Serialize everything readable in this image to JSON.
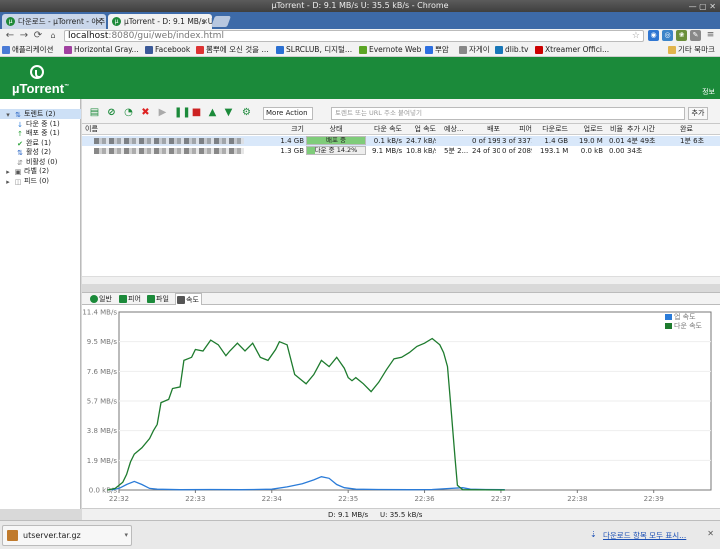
{
  "window": {
    "title": "µTorrent - D: 9.1 MB/s U: 35.5 kB/s - Chrome"
  },
  "tabs": [
    {
      "label": "다운로드 - µTorrent - 아주",
      "active": false
    },
    {
      "label": "µTorrent - D: 9.1 MB/s U",
      "active": true
    }
  ],
  "omnibox": {
    "host": "localhost",
    "path": ":8080/gui/web/index.html"
  },
  "bookmarks": [
    {
      "label": "애플리케이션",
      "color": "#4a7bd6"
    },
    {
      "label": "Horizontal Gray...",
      "color": "#a040a0"
    },
    {
      "label": "Facebook",
      "color": "#3b5998"
    },
    {
      "label": "뽐뿌에 오신 것을 ...",
      "color": "#d33"
    },
    {
      "label": "SLRCLUB, 디지털...",
      "color": "#2a6fd1"
    },
    {
      "label": "Evernote Web",
      "color": "#5ba525"
    },
    {
      "label": "뿌암",
      "color": "#2d6fe0"
    },
    {
      "label": "자게이",
      "color": "#888"
    },
    {
      "label": "dlib.tv",
      "color": "#1877b8"
    },
    {
      "label": "Xtreamer Offici...",
      "color": "#c00"
    },
    {
      "label": "기타 북마크",
      "color": "#e1b44c"
    }
  ],
  "header": {
    "logo": "µTorrent",
    "logo_tm": "™",
    "info_link": "정보"
  },
  "sidebar": {
    "categories": [
      {
        "label": "토렌트 (2)",
        "selected": true,
        "indent": 0,
        "icon": "torrents-icon",
        "glyph": "⇅",
        "color": "#2a66c5"
      },
      {
        "label": "다운 중 (1)",
        "selected": false,
        "indent": 1,
        "icon": "download-icon",
        "glyph": "↓",
        "color": "#2a7bd8"
      },
      {
        "label": "배포 중 (1)",
        "selected": false,
        "indent": 1,
        "icon": "upload-icon",
        "glyph": "↑",
        "color": "#2ea33c"
      },
      {
        "label": "완료 (1)",
        "selected": false,
        "indent": 1,
        "icon": "check-icon",
        "glyph": "✔",
        "color": "#2ea33c"
      },
      {
        "label": "활성 (2)",
        "selected": false,
        "indent": 1,
        "icon": "active-icon",
        "glyph": "⇅",
        "color": "#2a66c5"
      },
      {
        "label": "비활성 (0)",
        "selected": false,
        "indent": 1,
        "icon": "inactive-icon",
        "glyph": "⇵",
        "color": "#888"
      },
      {
        "label": "라벨 (2)",
        "selected": false,
        "indent": 0,
        "icon": "label-icon",
        "glyph": "▣",
        "color": "#555"
      },
      {
        "label": "피드 (0)",
        "selected": false,
        "indent": 0,
        "icon": "feed-icon",
        "glyph": "◫",
        "color": "#888"
      }
    ]
  },
  "toolbar": {
    "more_action": "More Action",
    "url_placeholder": "토렌트 또는 URL 주소 붙여넣기",
    "add_label": "추가"
  },
  "table": {
    "headers": [
      "이름",
      "크기",
      "상태",
      "다운 속도",
      "업 속도",
      "예상...",
      "배포",
      "피어",
      "다운로드",
      "업로드",
      "비율",
      "추가 시간",
      "완료"
    ],
    "rows": [
      {
        "size": "1.4 GB",
        "status": "배포 중",
        "progress": 1.0,
        "down": "0.1 kB/s",
        "up": "24.7 kB/s",
        "eta": "",
        "seeds": "0 of 199",
        "peers": "3 of 3371",
        "downloaded": "1.4 GB",
        "uploaded": "19.0 MB",
        "ratio": "0.01",
        "added": "4분 49초",
        "completed": "1분 6초",
        "selected": true
      },
      {
        "size": "1.3 GB",
        "status": "다운 중 14.2%",
        "progress": 0.142,
        "down": "9.1 MB/s",
        "up": "10.8 kB/s",
        "eta": "5분 2...",
        "seeds": "24 of 30",
        "peers": "0 of 2089",
        "downloaded": "193.1 MB",
        "uploaded": "0.0 kB",
        "ratio": "0.00",
        "added": "34초",
        "completed": "",
        "selected": false
      }
    ]
  },
  "detail_tabs": [
    {
      "label": "일반",
      "icon": "info-icon",
      "active": false
    },
    {
      "label": "피어",
      "icon": "peers-icon",
      "active": false
    },
    {
      "label": "파일",
      "icon": "files-icon",
      "active": false
    },
    {
      "label": "속도",
      "icon": "speed-icon",
      "active": true
    }
  ],
  "chart_data": {
    "type": "line",
    "x_labels": [
      "22:32",
      "22:33",
      "22:34",
      "22:35",
      "22:36",
      "22:37",
      "22:38",
      "22:39"
    ],
    "x_range": [
      0,
      7.75
    ],
    "y_labels": [
      "0.0 kB/s",
      "1.9 MB/s",
      "3.8 MB/s",
      "5.7 MB/s",
      "7.6 MB/s",
      "9.5 MB/s",
      "11.4 MB/s"
    ],
    "ylim": [
      0,
      11.4
    ],
    "y_unit": "MB/s",
    "series": [
      {
        "name": "업 속도",
        "color": "#2a7bd8",
        "points": [
          [
            -0.1,
            0
          ],
          [
            0.0,
            0.1
          ],
          [
            0.1,
            0.35
          ],
          [
            0.2,
            0.55
          ],
          [
            0.3,
            0.35
          ],
          [
            0.4,
            0.1
          ],
          [
            0.5,
            0.05
          ],
          [
            0.8,
            0.02
          ],
          [
            1.2,
            0.03
          ],
          [
            1.6,
            0.02
          ],
          [
            2.0,
            0.05
          ],
          [
            2.2,
            0.2
          ],
          [
            2.4,
            0.4
          ],
          [
            2.55,
            0.65
          ],
          [
            2.65,
            0.85
          ],
          [
            2.75,
            0.75
          ],
          [
            2.85,
            0.35
          ],
          [
            2.95,
            0.15
          ],
          [
            3.1,
            0.05
          ],
          [
            3.4,
            0.03
          ],
          [
            3.8,
            0.02
          ],
          [
            4.1,
            0.03
          ],
          [
            4.5,
            0.15
          ],
          [
            4.6,
            0.05
          ],
          [
            4.8,
            0.03
          ],
          [
            5.05,
            0.02
          ]
        ]
      },
      {
        "name": "다운 속도",
        "color": "#1e7b2e",
        "points": [
          [
            -0.15,
            0
          ],
          [
            -0.05,
            0.1
          ],
          [
            0.05,
            0.5
          ],
          [
            0.1,
            1.0
          ],
          [
            0.15,
            1.8
          ],
          [
            0.2,
            2.3
          ],
          [
            0.3,
            2.7
          ],
          [
            0.4,
            3.3
          ],
          [
            0.45,
            3.8
          ],
          [
            0.5,
            4.2
          ],
          [
            0.55,
            5.6
          ],
          [
            0.65,
            5.8
          ],
          [
            0.7,
            6.5
          ],
          [
            0.8,
            6.6
          ],
          [
            0.85,
            8.3
          ],
          [
            0.95,
            8.5
          ],
          [
            1.0,
            9.0
          ],
          [
            1.1,
            8.9
          ],
          [
            1.2,
            9.6
          ],
          [
            1.3,
            9.3
          ],
          [
            1.4,
            8.6
          ],
          [
            1.45,
            8.9
          ],
          [
            1.55,
            9.4
          ],
          [
            1.65,
            8.9
          ],
          [
            1.75,
            9.4
          ],
          [
            1.85,
            8.5
          ],
          [
            1.95,
            8.3
          ],
          [
            2.05,
            9.0
          ],
          [
            2.1,
            9.5
          ],
          [
            2.2,
            9.3
          ],
          [
            2.3,
            7.4
          ],
          [
            2.4,
            7.0
          ],
          [
            2.45,
            6.8
          ],
          [
            2.55,
            7.4
          ],
          [
            2.65,
            8.3
          ],
          [
            2.75,
            7.9
          ],
          [
            2.85,
            8.5
          ],
          [
            2.95,
            7.8
          ],
          [
            3.0,
            7.2
          ],
          [
            3.05,
            7.0
          ],
          [
            3.1,
            7.2
          ],
          [
            3.2,
            6.8
          ],
          [
            3.3,
            6.3
          ],
          [
            3.4,
            6.9
          ],
          [
            3.5,
            7.7
          ],
          [
            3.6,
            8.4
          ],
          [
            3.7,
            8.5
          ],
          [
            3.8,
            8.8
          ],
          [
            3.9,
            9.2
          ],
          [
            4.0,
            9.4
          ],
          [
            4.1,
            9.7
          ],
          [
            4.2,
            9.3
          ],
          [
            4.25,
            8.8
          ],
          [
            4.3,
            7.9
          ],
          [
            4.35,
            5.0
          ],
          [
            4.4,
            2.0
          ],
          [
            4.43,
            0.3
          ],
          [
            4.5,
            0.02
          ],
          [
            5.05,
            0.0
          ]
        ]
      }
    ]
  },
  "status": {
    "down": "D: 9.1 MB/s",
    "up": "U: 35.5 kB/s"
  },
  "downloads": {
    "file": "utserver.tar.gz",
    "show_all": "다운로드 항목 모두 표시..."
  }
}
